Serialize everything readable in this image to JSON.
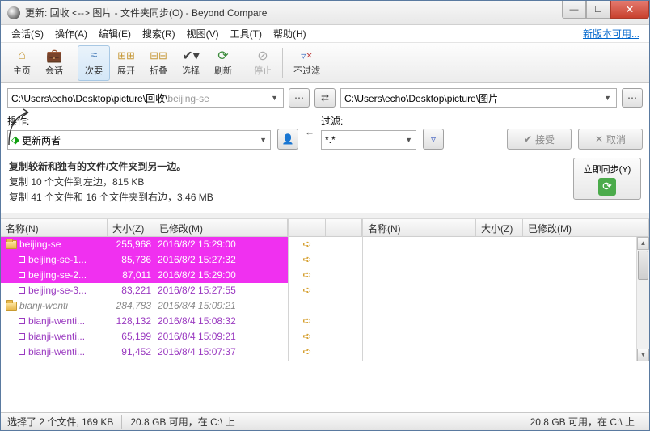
{
  "window": {
    "title": "更新: 回收 <--> 图片 - 文件夹同步(O) - Beyond Compare"
  },
  "menu": {
    "items": [
      "会话(S)",
      "操作(A)",
      "编辑(E)",
      "搜索(R)",
      "视图(V)",
      "工具(T)",
      "帮助(H)"
    ],
    "update": "新版本可用..."
  },
  "toolbar": {
    "home": "主页",
    "sessions": "会话",
    "minor": "次要",
    "expand": "展开",
    "collapse": "折叠",
    "select": "选择",
    "refresh": "刷新",
    "stop": "停止",
    "nofilter": "不过滤"
  },
  "paths": {
    "left_prefix": "C:\\Users\\echo\\Desktop\\picture\\回收\\",
    "left_ghost": "beijing-se",
    "right": "C:\\Users\\echo\\Desktop\\picture\\图片"
  },
  "op": {
    "label": "操作:",
    "value": "更新两者",
    "filter_label": "过滤:",
    "filter_value": "*.*",
    "accept": "接受",
    "cancel": "取消",
    "sync": "立即同步(Y)"
  },
  "summary": {
    "line1": "复制较新和独有的文件/文件夹到另一边。",
    "line2": "复制 10 个文件到左边，815 KB",
    "line3": "复制 41 个文件和 16 个文件夹到右边，3.46 MB"
  },
  "cols": {
    "name": "名称(N)",
    "size": "大小(Z)",
    "modified": "已修改(M)"
  },
  "rows_left": [
    {
      "kind": "folder",
      "sel": true,
      "icon": "folder",
      "name": "beijing-se",
      "size": "255,968",
      "mod": "2016/8/2 15:29:00",
      "arrow": "➪"
    },
    {
      "kind": "file",
      "sel": true,
      "indent": 1,
      "icon": "box",
      "name": "beijing-se-1...",
      "size": "85,736",
      "mod": "2016/8/2 15:27:32",
      "arrow": "➪"
    },
    {
      "kind": "file",
      "sel": true,
      "indent": 1,
      "icon": "box",
      "name": "beijing-se-2...",
      "size": "87,011",
      "mod": "2016/8/2 15:29:00",
      "arrow": "➪"
    },
    {
      "kind": "file",
      "sel": false,
      "indent": 1,
      "icon": "box",
      "cls": "purple",
      "name": "beijing-se-3...",
      "size": "83,221",
      "mod": "2016/8/2 15:27:55",
      "arrow": "➪"
    },
    {
      "kind": "folder",
      "sel": false,
      "icon": "folder",
      "cls": "grayit",
      "name": "bianji-wenti",
      "size": "284,783",
      "mod": "2016/8/4 15:09:21",
      "arrow": ""
    },
    {
      "kind": "file",
      "sel": false,
      "indent": 1,
      "icon": "box",
      "cls": "purple",
      "name": "bianji-wenti...",
      "size": "128,132",
      "mod": "2016/8/4 15:08:32",
      "arrow": "➪"
    },
    {
      "kind": "file",
      "sel": false,
      "indent": 1,
      "icon": "box",
      "cls": "purple",
      "name": "bianji-wenti...",
      "size": "65,199",
      "mod": "2016/8/4 15:09:21",
      "arrow": "➪"
    },
    {
      "kind": "file",
      "sel": false,
      "indent": 1,
      "icon": "box",
      "cls": "purple",
      "name": "bianji-wenti...",
      "size": "91,452",
      "mod": "2016/8/4 15:07:37",
      "arrow": "➪"
    }
  ],
  "status": {
    "selection": "选择了 2 个文件, 169 KB",
    "disk_left": "20.8 GB 可用，在 C:\\ 上",
    "disk_right": "20.8 GB 可用，在 C:\\ 上"
  }
}
